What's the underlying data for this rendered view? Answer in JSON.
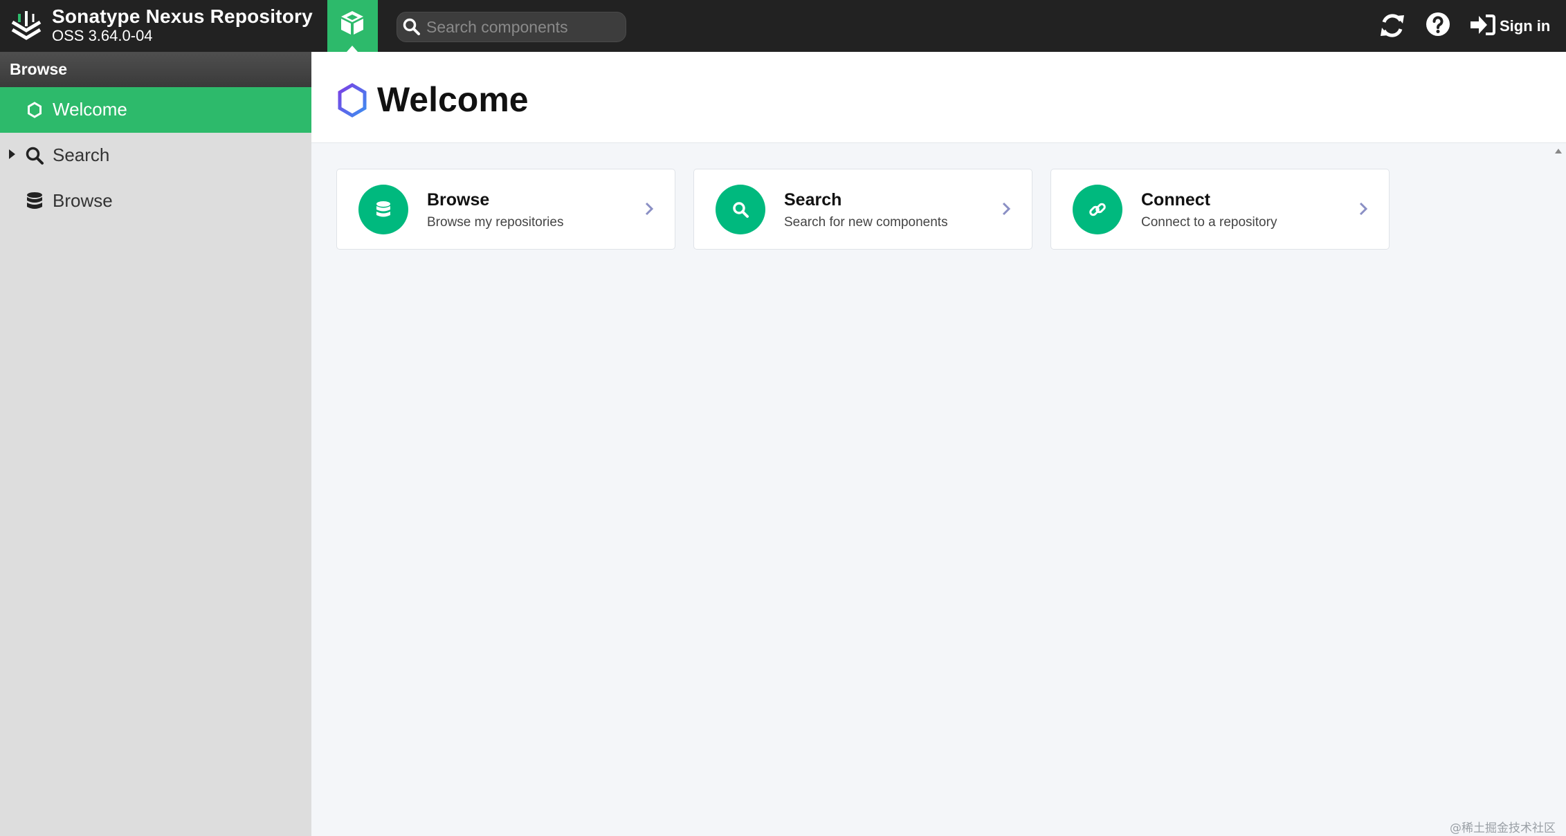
{
  "header": {
    "brand_title": "Sonatype Nexus Repository",
    "brand_version": "OSS 3.64.0-04",
    "search_placeholder": "Search components",
    "signin_label": "Sign in",
    "icons": [
      "nexus-logo-icon",
      "cube-icon",
      "search-icon",
      "refresh-icon",
      "help-icon",
      "sign-in-icon"
    ]
  },
  "sidebar": {
    "section_title": "Browse",
    "items": [
      {
        "label": "Welcome",
        "icon": "hexagon-icon",
        "active": true
      },
      {
        "label": "Search",
        "icon": "search-icon",
        "expandable": true
      },
      {
        "label": "Browse",
        "icon": "database-icon"
      }
    ]
  },
  "main": {
    "title": "Welcome",
    "cards": [
      {
        "title": "Browse",
        "subtitle": "Browse my repositories",
        "icon": "database-icon"
      },
      {
        "title": "Search",
        "subtitle": "Search for new components",
        "icon": "search-icon"
      },
      {
        "title": "Connect",
        "subtitle": "Connect to a repository",
        "icon": "link-icon"
      }
    ]
  },
  "watermark": "@稀土掘金技术社区",
  "colors": {
    "header_bg": "#222222",
    "accent_green": "#2dba6b",
    "card_icon_green": "#00b97e",
    "sidebar_bg": "#dddddd",
    "main_bg": "#f4f6f9"
  }
}
